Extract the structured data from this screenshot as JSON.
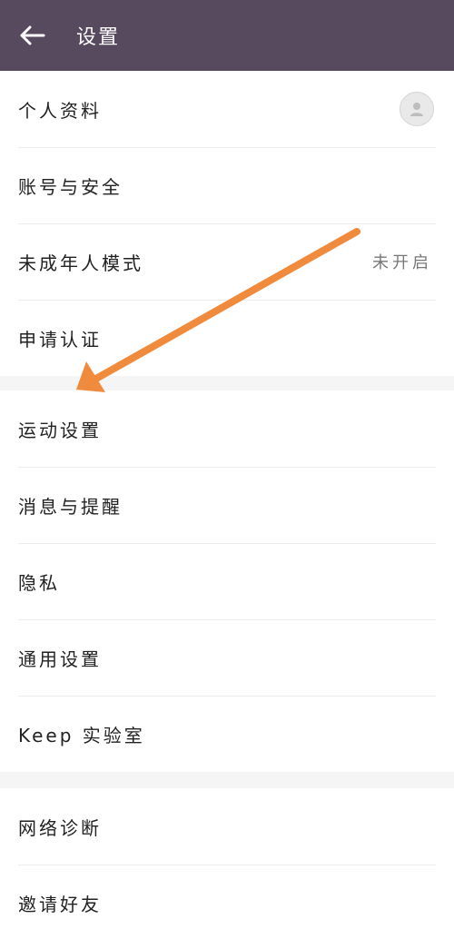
{
  "app_bar": {
    "title": "设置",
    "back_icon": "back-arrow-icon",
    "background": "#574a5f"
  },
  "groups": [
    {
      "items": [
        {
          "label": "个人资料",
          "trailing": "avatar-icon"
        },
        {
          "label": "账号与安全"
        },
        {
          "label": "未成年人模式",
          "value": "未开启"
        },
        {
          "label": "申请认证"
        }
      ]
    },
    {
      "items": [
        {
          "label": "运动设置"
        },
        {
          "label": "消息与提醒"
        },
        {
          "label": "隐私"
        },
        {
          "label": "通用设置"
        },
        {
          "label": "Keep 实验室"
        }
      ]
    },
    {
      "items": [
        {
          "label": "网络诊断"
        },
        {
          "label": "邀请好友"
        }
      ]
    }
  ],
  "annotation": {
    "type": "arrow",
    "color": "#f08a3c",
    "points_to": "运动设置"
  }
}
